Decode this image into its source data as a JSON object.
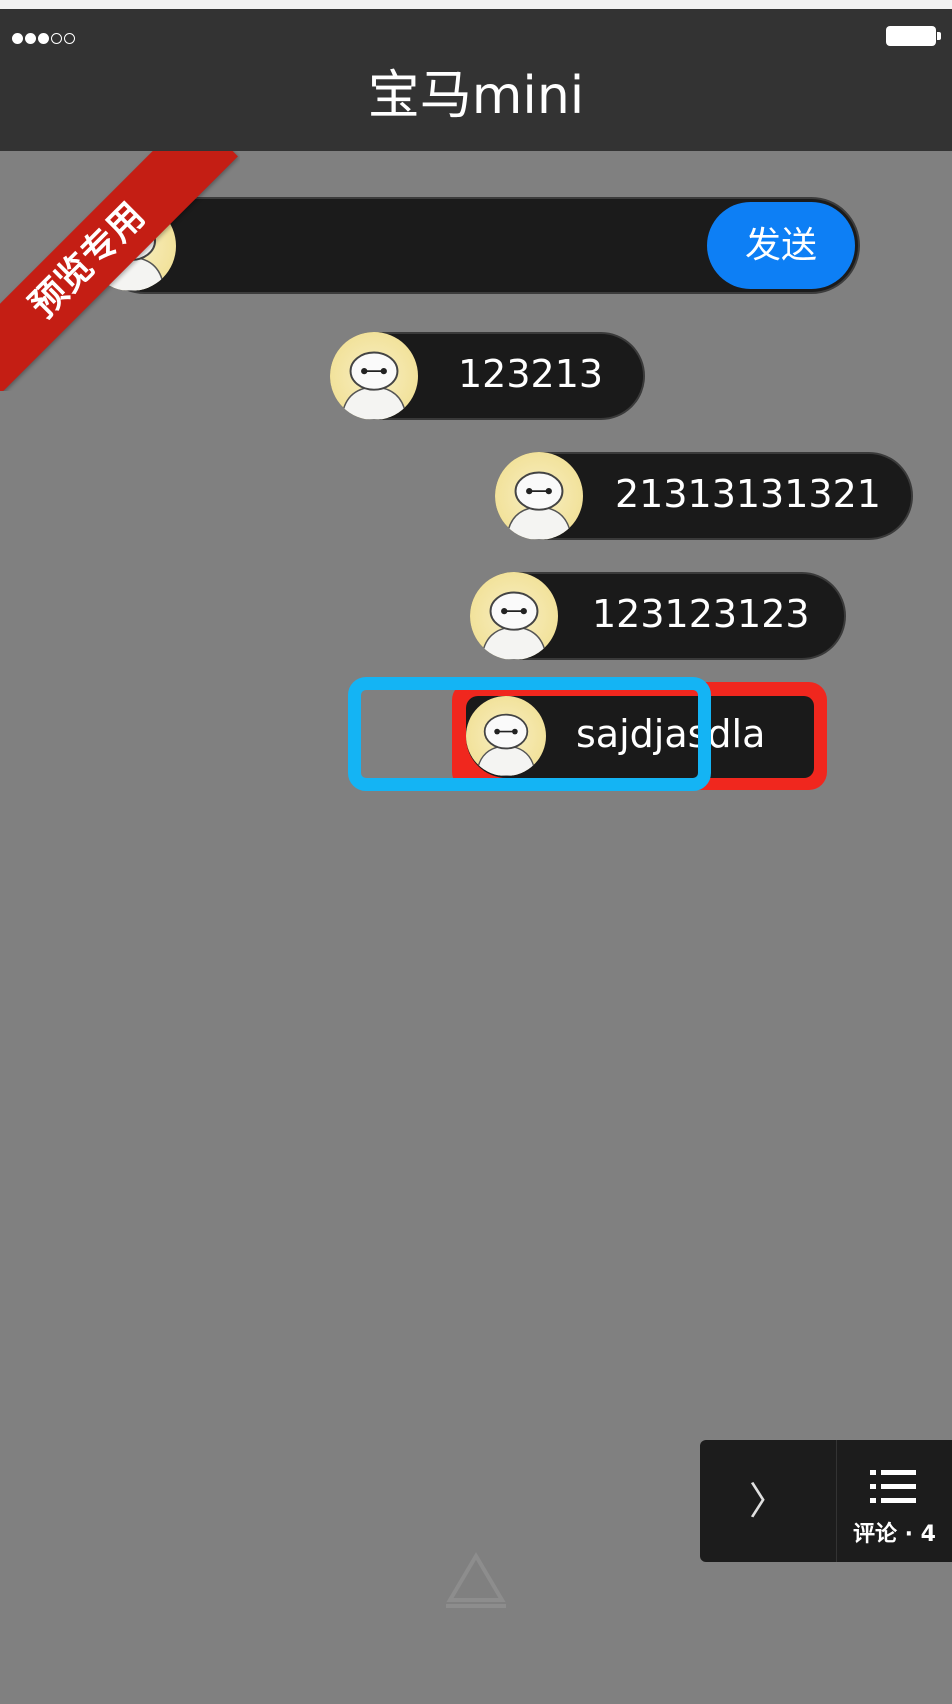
{
  "status_bar": {
    "signal_dots": [
      "full",
      "full",
      "full",
      "empty",
      "empty"
    ]
  },
  "header": {
    "title": "宝马mini"
  },
  "ribbon": {
    "text": "预览专用"
  },
  "composer": {
    "input_value": "",
    "send_label": "发送",
    "avatar_icon": "baymax-avatar-icon"
  },
  "messages": [
    {
      "text": "123213"
    },
    {
      "text": "21313131321"
    },
    {
      "text": "123123123"
    },
    {
      "text": "sajdjasdla"
    }
  ],
  "comment_bar": {
    "chevron": "〉",
    "label": "评论 · 4",
    "icon": "list-icon"
  },
  "colors": {
    "background": "#808080",
    "header": "#333333",
    "send_button": "#0d7ff5",
    "ribbon": "#c41e14",
    "highlight_red": "#f0271e",
    "highlight_blue": "#14b4f4"
  }
}
